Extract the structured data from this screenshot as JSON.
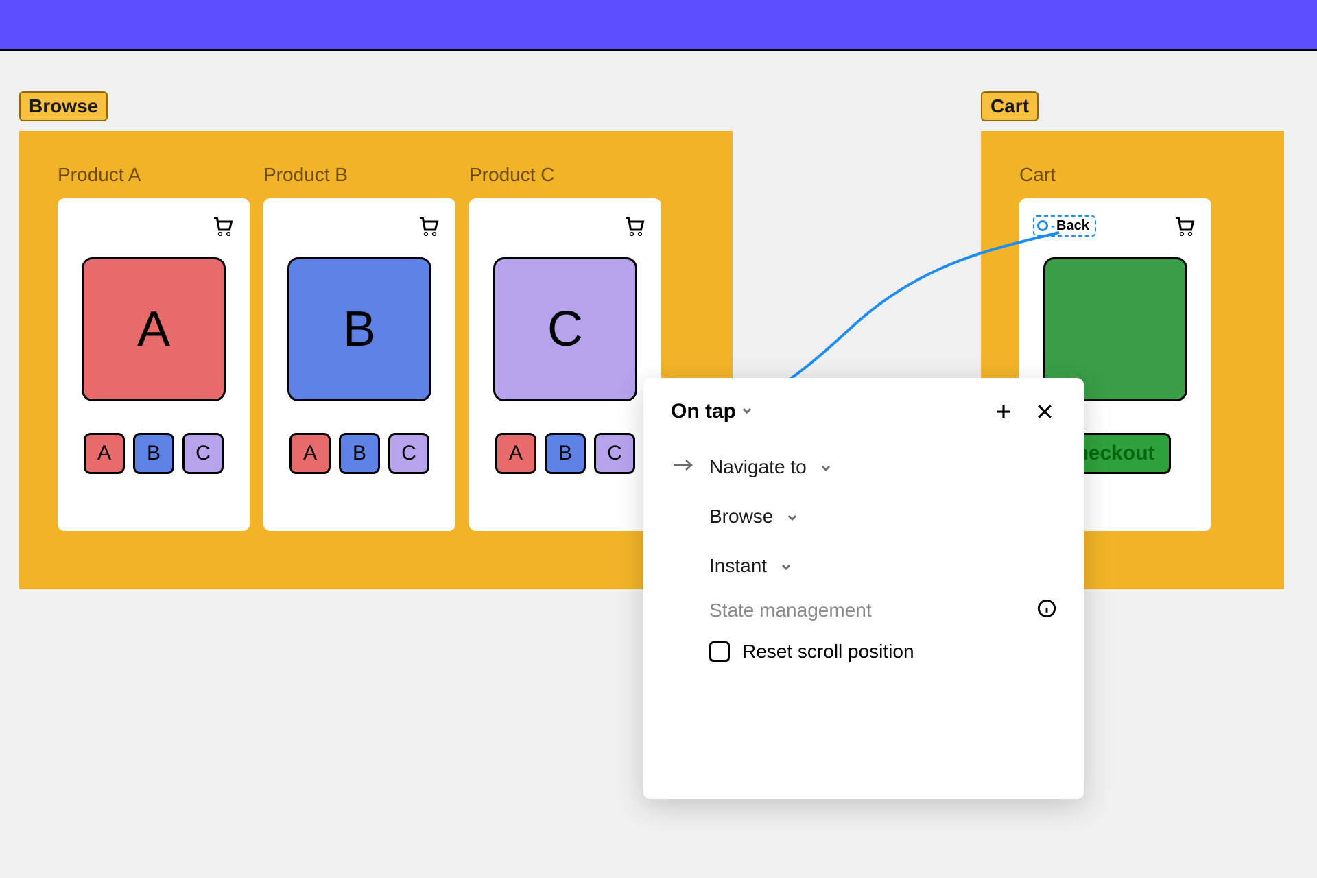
{
  "flows": {
    "browse": {
      "label": "Browse",
      "products": [
        {
          "title": "Product A",
          "hero_letter": "A",
          "hero_color": "red",
          "chips": [
            "A",
            "B",
            "C"
          ]
        },
        {
          "title": "Product B",
          "hero_letter": "B",
          "hero_color": "blue",
          "chips": [
            "A",
            "B",
            "C"
          ]
        },
        {
          "title": "Product C",
          "hero_letter": "C",
          "hero_color": "purple",
          "chips": [
            "A",
            "B",
            "C"
          ]
        }
      ]
    },
    "cart": {
      "label": "Cart",
      "frame_title": "Cart",
      "back_label": "Back",
      "checkout_label": "heckout"
    }
  },
  "panel": {
    "trigger": "On tap",
    "action_label": "Navigate to",
    "destination": "Browse",
    "animation": "Instant",
    "section_label": "State management",
    "reset_label": "Reset scroll position",
    "reset_checked": false
  },
  "colors": {
    "accent": "#5d4fff",
    "flow_bg": "#f1b429",
    "connection": "#1d8df0"
  }
}
